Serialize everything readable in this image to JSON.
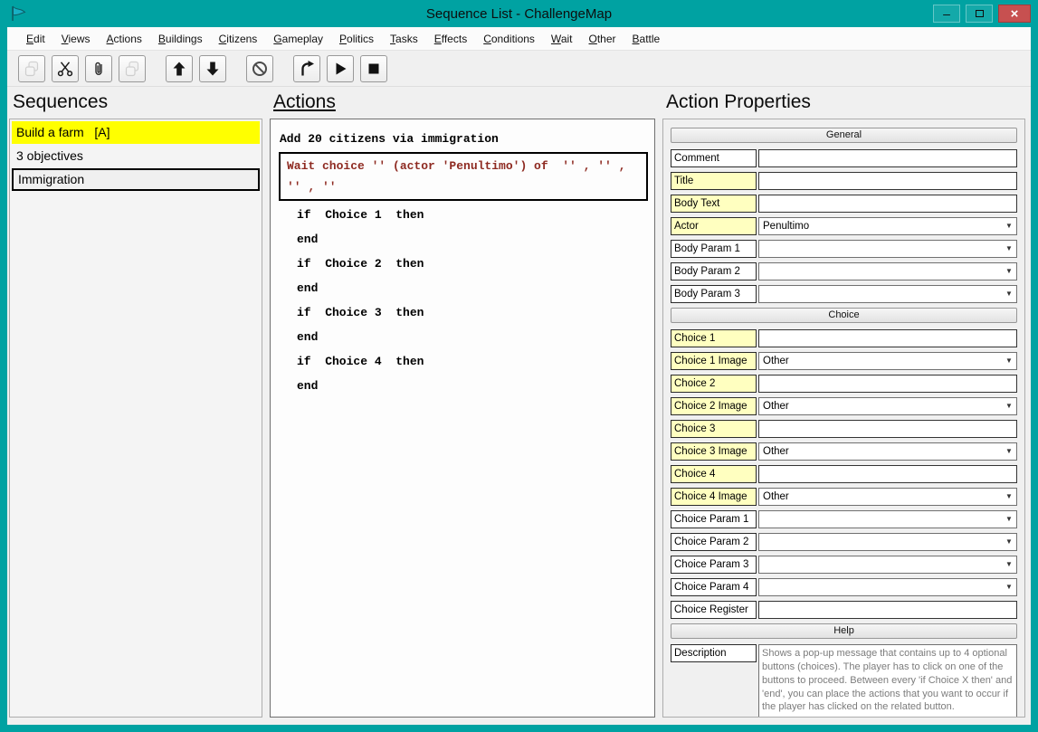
{
  "window": {
    "title": "Sequence List - ChallengeMap",
    "controls": {
      "minimize": "–",
      "close": "×"
    }
  },
  "colors": {
    "titlebar": "#00a2a2",
    "close_button": "#c75050",
    "selected_sequence": "#ffff00",
    "label_highlight": "#ffffc0",
    "selected_action_text": "#8e2a21"
  },
  "menu": {
    "items": [
      "Edit",
      "Views",
      "Actions",
      "Buildings",
      "Citizens",
      "Gameplay",
      "Politics",
      "Tasks",
      "Effects",
      "Conditions",
      "Wait",
      "Other",
      "Battle"
    ]
  },
  "toolbar": {
    "buttons": [
      {
        "name": "duplicate",
        "icon": "copy",
        "disabled": true
      },
      {
        "name": "cut",
        "icon": "scissors",
        "disabled": false
      },
      {
        "name": "paste",
        "icon": "paperclip",
        "disabled": false
      },
      {
        "name": "copy",
        "icon": "copy",
        "disabled": true
      },
      {
        "name": "move-up",
        "icon": "arrow-up",
        "gap": true
      },
      {
        "name": "move-down",
        "icon": "arrow-down"
      },
      {
        "name": "disable",
        "icon": "block",
        "gap": true
      },
      {
        "name": "jump",
        "icon": "curved-arrow",
        "gap": true
      },
      {
        "name": "play",
        "icon": "play"
      },
      {
        "name": "stop",
        "icon": "stop"
      }
    ]
  },
  "sequences": {
    "heading": "Sequences",
    "items": [
      {
        "text": "Build a farm   [A]",
        "style": "selected-yellow"
      },
      {
        "text": "3 objectives",
        "style": "plain"
      },
      {
        "text": "Immigration",
        "style": "focused"
      }
    ]
  },
  "actions": {
    "heading": "Actions",
    "items": [
      {
        "text": "Add 20 citizens via immigration",
        "kind": "plain"
      },
      {
        "text": "Wait choice '' (actor 'Penultimo') of  '' , '' , '' , ''",
        "kind": "selected"
      },
      {
        "text": "if  Choice 1  then",
        "kind": "indent"
      },
      {
        "text": "end",
        "kind": "indent"
      },
      {
        "text": "if  Choice 2  then",
        "kind": "indent"
      },
      {
        "text": "end",
        "kind": "indent"
      },
      {
        "text": "if  Choice 3  then",
        "kind": "indent"
      },
      {
        "text": "end",
        "kind": "indent"
      },
      {
        "text": "if  Choice 4  then",
        "kind": "indent"
      },
      {
        "text": "end",
        "kind": "indent"
      }
    ]
  },
  "properties": {
    "heading": "Action Properties",
    "rows": [
      {
        "type": "header",
        "label": "General"
      },
      {
        "type": "text",
        "label": "Comment",
        "value": "",
        "yellow": false
      },
      {
        "type": "text",
        "label": "Title",
        "value": "",
        "yellow": true
      },
      {
        "type": "text",
        "label": "Body Text",
        "value": "",
        "yellow": true
      },
      {
        "type": "select",
        "label": "Actor",
        "value": "Penultimo",
        "yellow": true
      },
      {
        "type": "select",
        "label": "Body Param 1",
        "value": "",
        "yellow": false
      },
      {
        "type": "select",
        "label": "Body Param 2",
        "value": "",
        "yellow": false
      },
      {
        "type": "select",
        "label": "Body Param 3",
        "value": "",
        "yellow": false
      },
      {
        "type": "header",
        "label": "Choice"
      },
      {
        "type": "text",
        "label": "Choice 1",
        "value": "",
        "yellow": true
      },
      {
        "type": "select",
        "label": "Choice 1 Image",
        "value": "Other",
        "yellow": true
      },
      {
        "type": "text",
        "label": "Choice 2",
        "value": "",
        "yellow": true
      },
      {
        "type": "select",
        "label": "Choice 2 Image",
        "value": "Other",
        "yellow": true
      },
      {
        "type": "text",
        "label": "Choice 3",
        "value": "",
        "yellow": true
      },
      {
        "type": "select",
        "label": "Choice 3 Image",
        "value": "Other",
        "yellow": true
      },
      {
        "type": "text",
        "label": "Choice 4",
        "value": "",
        "yellow": true
      },
      {
        "type": "select",
        "label": "Choice 4 Image",
        "value": "Other",
        "yellow": true
      },
      {
        "type": "select",
        "label": "Choice Param 1",
        "value": "",
        "yellow": false
      },
      {
        "type": "select",
        "label": "Choice Param 2",
        "value": "",
        "yellow": false
      },
      {
        "type": "select",
        "label": "Choice Param 3",
        "value": "",
        "yellow": false
      },
      {
        "type": "select",
        "label": "Choice Param 4",
        "value": "",
        "yellow": false
      },
      {
        "type": "text",
        "label": "Choice Register",
        "value": "",
        "yellow": false
      },
      {
        "type": "header",
        "label": "Help"
      },
      {
        "type": "textarea",
        "label": "Description",
        "yellow": false,
        "value": "Shows a pop-up message that contains up to 4 optional buttons (choices). The player has to click on one of the buttons to proceed. Between every 'if Choice X then' and 'end', you can place the actions that you want to occur if the player has clicked on the related button."
      }
    ]
  }
}
